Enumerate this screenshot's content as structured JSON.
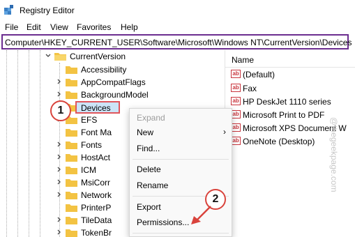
{
  "window": {
    "title": "Registry Editor"
  },
  "menubar": {
    "file": "File",
    "edit": "Edit",
    "view": "View",
    "favorites": "Favorites",
    "help": "Help"
  },
  "address": {
    "path": "Computer\\HKEY_CURRENT_USER\\Software\\Microsoft\\Windows NT\\CurrentVersion\\Devices"
  },
  "tree": {
    "current_version": "CurrentVersion",
    "items": [
      "Accessibility",
      "AppCompatFlags",
      "BackgroundModel",
      "Devices",
      "EFS",
      "Font Ma",
      "Fonts",
      "HostAct",
      "ICM",
      "MsiCorr",
      "Network",
      "PrinterP",
      "TileData",
      "TokenBr"
    ]
  },
  "values": {
    "column_name": "Name",
    "items": [
      "(Default)",
      "Fax",
      "HP DeskJet 1110 series",
      "Microsoft Print to PDF",
      "Microsoft XPS Document W",
      "OneNote (Desktop)"
    ],
    "icon_text": "ab"
  },
  "context_menu": {
    "expand": "Expand",
    "new": "New",
    "find": "Find...",
    "delete": "Delete",
    "rename": "Rename",
    "export": "Export",
    "permissions": "Permissions..."
  },
  "annotations": {
    "step1": "1",
    "step2": "2"
  },
  "watermark": "@thegeekpage.com",
  "colors": {
    "address_border": "#6b2d8f",
    "highlight_border": "#e0555b",
    "selection": "#cce4f7",
    "badge": "#d9433c",
    "folder": "#f3c343"
  }
}
